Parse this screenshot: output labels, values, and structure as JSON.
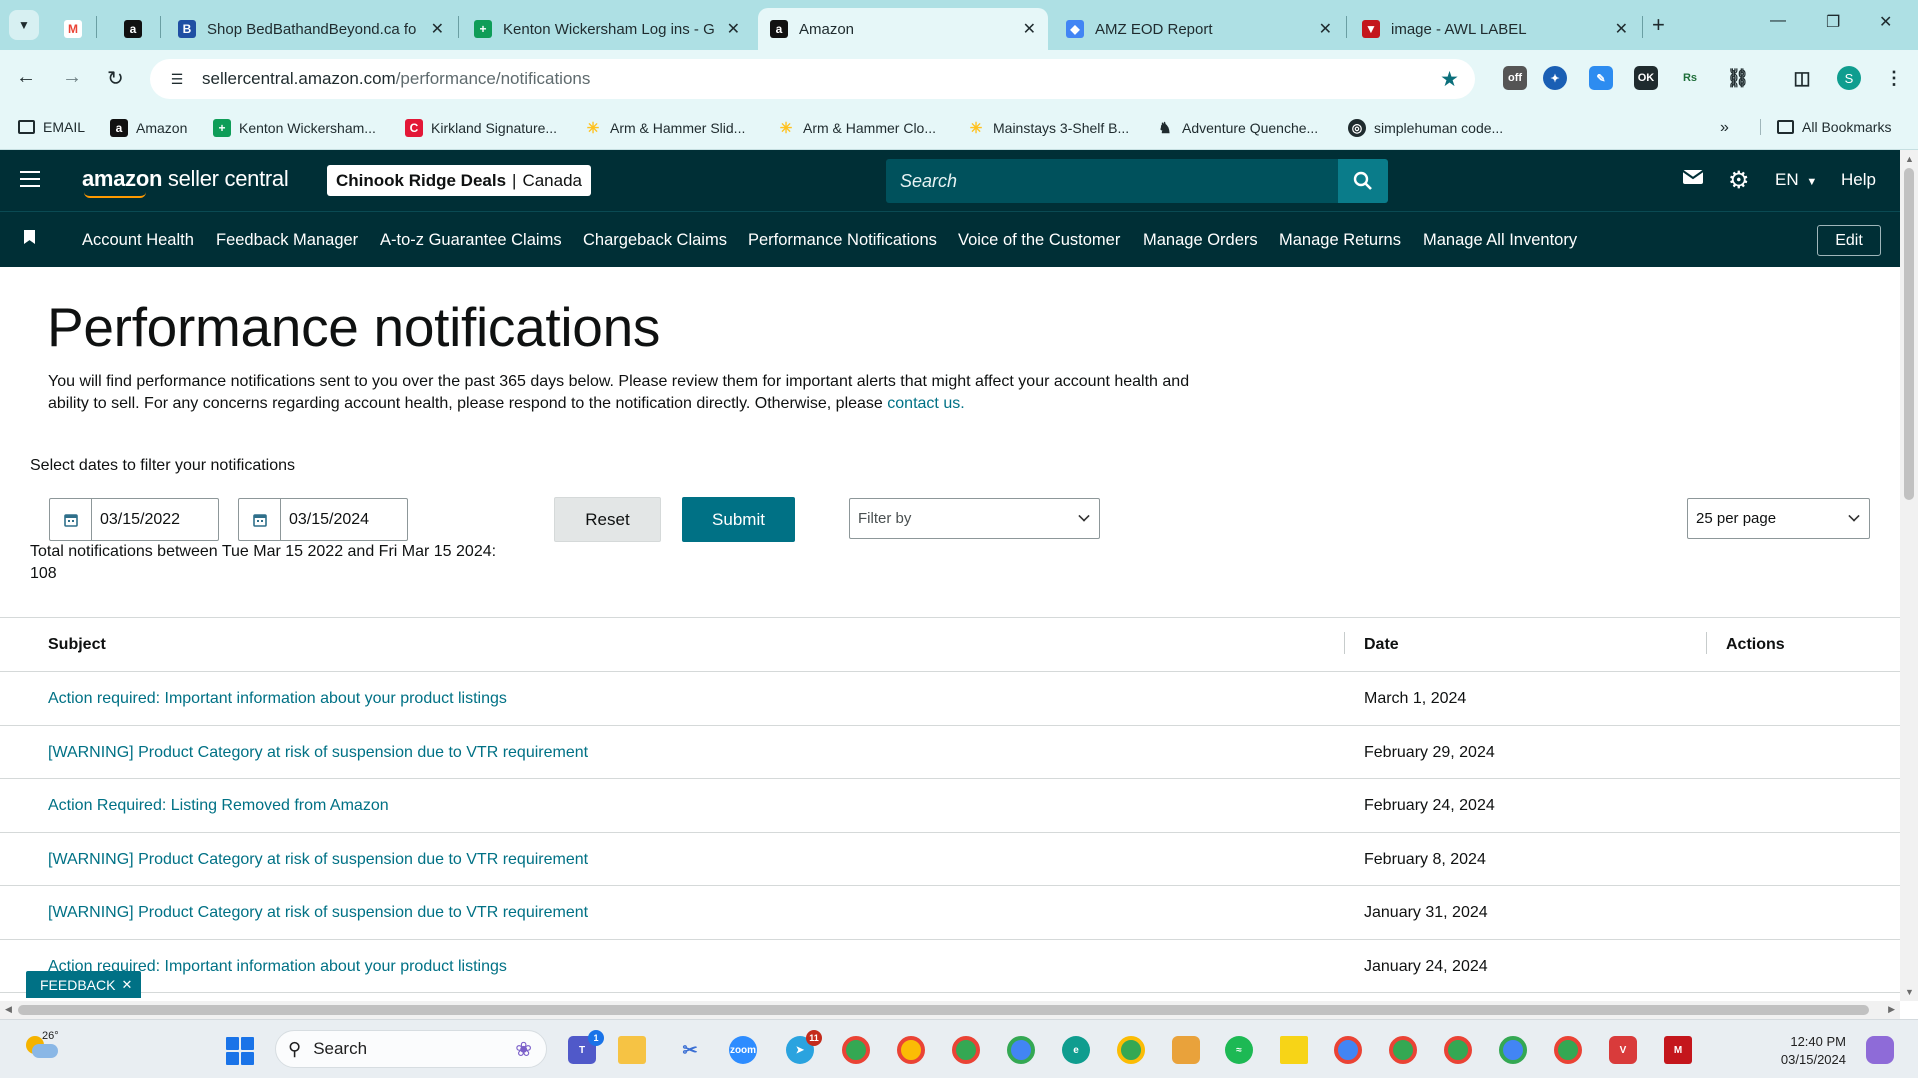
{
  "browser": {
    "tabs": [
      {
        "title": "",
        "favicon": "gmail-icon",
        "color": "#ea4335"
      },
      {
        "title": "",
        "favicon": "amazon-icon",
        "color": "#111111"
      },
      {
        "title": "Shop BedBathandBeyond.ca fo",
        "favicon": "b-icon",
        "color": "#1f4fa3"
      },
      {
        "title": "Kenton Wickersham Log ins - G",
        "favicon": "sheets-plus-icon",
        "color": "#0f9d58"
      },
      {
        "title": "Amazon",
        "favicon": "amazon-icon",
        "color": "#111111",
        "active": true
      },
      {
        "title": "AMZ EOD Report",
        "favicon": "looker-icon",
        "color": "#4285f4"
      },
      {
        "title": "image - AWL LABEL",
        "favicon": "awl-icon",
        "color": "#c4161c"
      }
    ],
    "url_domain": "sellercentral.amazon.com",
    "url_path": "/performance/notifications",
    "bookmarks": [
      {
        "label": "EMAIL",
        "icon": "folder-icon"
      },
      {
        "label": "Amazon",
        "icon": "amazon-icon"
      },
      {
        "label": "Kenton Wickersham...",
        "icon": "sheets-plus-icon"
      },
      {
        "label": "Kirkland Signature...",
        "icon": "costco-icon"
      },
      {
        "label": "Arm & Hammer Slid...",
        "icon": "walmart-icon"
      },
      {
        "label": "Arm & Hammer Clo...",
        "icon": "walmart-icon"
      },
      {
        "label": "Mainstays 3-Shelf B...",
        "icon": "walmart-icon"
      },
      {
        "label": "Adventure Quenche...",
        "icon": "moose-icon"
      },
      {
        "label": "simplehuman code...",
        "icon": "globe-icon"
      }
    ],
    "all_bookmarks": "All Bookmarks"
  },
  "header": {
    "logo_bold": "amazon",
    "logo_rest": " seller central",
    "store_name": "Chinook Ridge Deals",
    "store_region": "Canada",
    "search_placeholder": "Search",
    "language": "EN",
    "help": "Help"
  },
  "nav": {
    "items": [
      "Account Health",
      "Feedback Manager",
      "A-to-z Guarantee Claims",
      "Chargeback Claims",
      "Performance Notifications",
      "Voice of the Customer",
      "Manage Orders",
      "Manage Returns",
      "Manage All Inventory"
    ],
    "edit": "Edit"
  },
  "page": {
    "title": "Performance notifications",
    "intro_line1": "You will find performance notifications sent to you over the past 365 days below. Please review them for important alerts that might affect your account health and",
    "intro_line2": "ability to sell. For any concerns regarding account health, please respond to the notification directly. Otherwise, please ",
    "intro_link": "contact us",
    "intro_end": ".",
    "filter_label": "Select dates to filter your notifications",
    "date_from": "03/15/2022",
    "date_to": "03/15/2024",
    "reset": "Reset",
    "submit": "Submit",
    "filter_placeholder": "Filter by",
    "per_page": "25 per page",
    "total_line": "Total notifications between Tue Mar 15 2022 and Fri Mar 15 2024:",
    "total_count": "108"
  },
  "table": {
    "headers": {
      "subject": "Subject",
      "date": "Date",
      "actions": "Actions"
    },
    "rows": [
      {
        "subject": "Action required: Important information about your product listings",
        "date": "March 1, 2024"
      },
      {
        "subject": "[WARNING] Product Category at risk of suspension due to VTR requirement",
        "date": "February 29, 2024"
      },
      {
        "subject": "Action Required: Listing Removed from Amazon",
        "date": "February 24, 2024"
      },
      {
        "subject": "[WARNING] Product Category at risk of suspension due to VTR requirement",
        "date": "February 8, 2024"
      },
      {
        "subject": "[WARNING] Product Category at risk of suspension due to VTR requirement",
        "date": "January 31, 2024"
      },
      {
        "subject": "Action required: Important information about your product listings",
        "date": "January 24, 2024"
      }
    ]
  },
  "feedback": "FEEDBACK",
  "taskbar": {
    "temperature": "26°",
    "search": "Search",
    "time": "12:40 PM",
    "date": "03/15/2024",
    "badges": {
      "teams": "1",
      "telegram": "11"
    }
  }
}
